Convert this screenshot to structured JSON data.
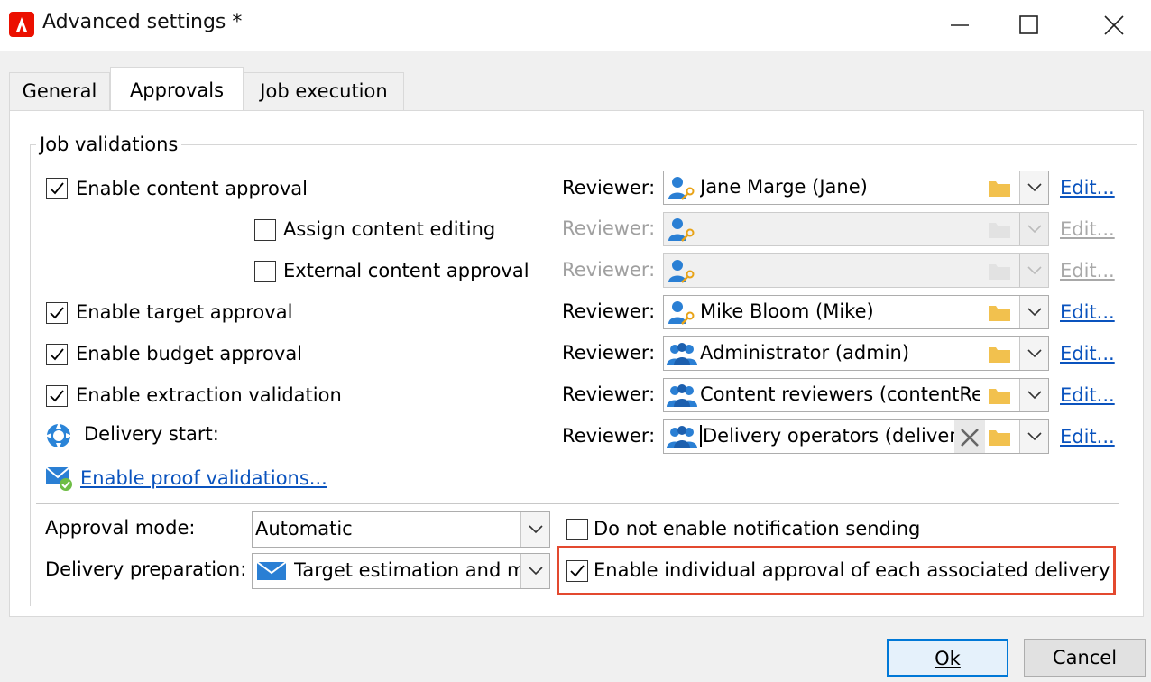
{
  "window": {
    "title": "Advanced settings *",
    "app_icon": "adobe-campaign-icon"
  },
  "tabs": [
    {
      "label": "General"
    },
    {
      "label": "Approvals",
      "active": true
    },
    {
      "label": "Job execution"
    }
  ],
  "job_validations": {
    "title": "Job validations",
    "rows": [
      {
        "label": "Enable content approval",
        "checked": true,
        "reviewer_label": "Reviewer:",
        "reviewer": "Jane Marge (Jane)",
        "edit": "Edit...",
        "enabled": true,
        "icon": "user-key-icon"
      },
      {
        "label": "Assign content editing",
        "checked": false,
        "reviewer_label": "Reviewer:",
        "reviewer": "",
        "edit": "Edit...",
        "enabled": false,
        "icon": "user-key-icon"
      },
      {
        "label": "External content approval",
        "checked": false,
        "reviewer_label": "Reviewer:",
        "reviewer": "",
        "edit": "Edit...",
        "enabled": false,
        "icon": "user-key-icon"
      },
      {
        "label": "Enable target approval",
        "checked": true,
        "reviewer_label": "Reviewer:",
        "reviewer": "Mike Bloom (Mike)",
        "edit": "Edit...",
        "enabled": true,
        "icon": "user-key-icon"
      },
      {
        "label": "Enable budget approval",
        "checked": true,
        "reviewer_label": "Reviewer:",
        "reviewer": "Administrator (admin)",
        "edit": "Edit...",
        "enabled": true,
        "icon": "user-group-icon"
      },
      {
        "label": "Enable extraction validation",
        "checked": true,
        "reviewer_label": "Reviewer:",
        "reviewer": "Content reviewers (contentRe",
        "edit": "Edit...",
        "enabled": true,
        "icon": "user-group-icon"
      },
      {
        "label": "Delivery start:",
        "checked": null,
        "reviewer_label": "Reviewer:",
        "reviewer": "Delivery operators (delivery",
        "edit": "Edit...",
        "enabled": true,
        "icon": "user-group-icon"
      }
    ],
    "proof_link": "Enable proof validations..."
  },
  "approval_mode": {
    "label": "Approval mode:",
    "value": "Automatic"
  },
  "delivery_preparation": {
    "label": "Delivery preparation:",
    "value": "Target estimation and m"
  },
  "options": {
    "no_notification": {
      "label": "Do not enable notification sending",
      "checked": false
    },
    "individual_approval": {
      "label": "Enable individual approval of each associated delivery",
      "checked": true
    }
  },
  "buttons": {
    "ok": "Ok",
    "cancel": "Cancel"
  },
  "colors": {
    "accent": "#0078d7",
    "link": "#0a53be",
    "highlight": "#e3492f",
    "adobe_red": "#eb1000",
    "folder": "#f2c14e"
  }
}
